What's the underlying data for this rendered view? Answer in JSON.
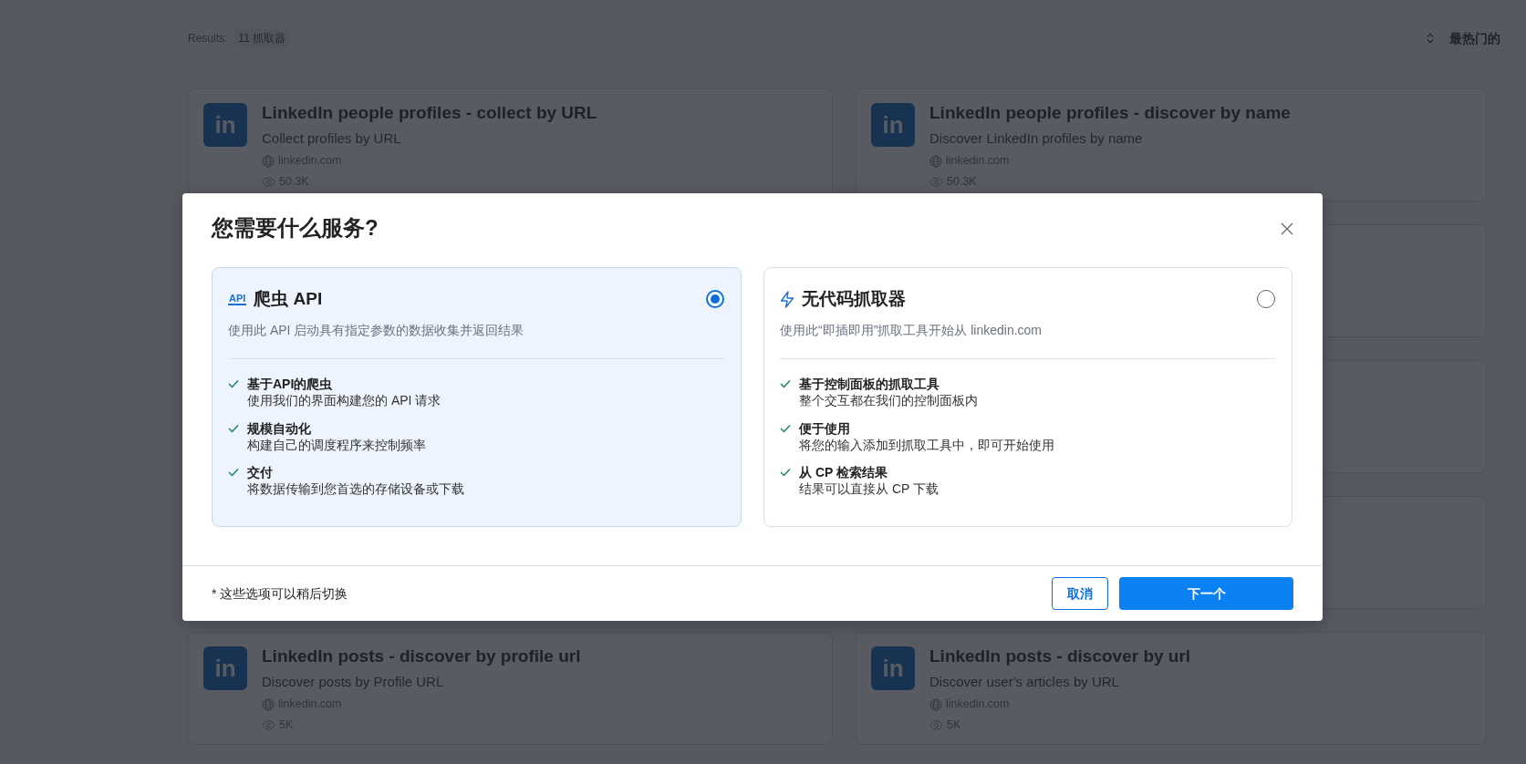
{
  "results": {
    "label": "Results:",
    "count": "11 抓取器"
  },
  "sort": {
    "label": "最热门的"
  },
  "cards": [
    {
      "logo": "in",
      "title": "LinkedIn people profiles - collect by URL",
      "subtitle": "Collect profiles by URL",
      "domain": "linkedin.com",
      "views": "50.3K"
    },
    {
      "logo": "in",
      "title": "LinkedIn people profiles - discover by name",
      "subtitle": "Discover LinkedIn profiles by name",
      "domain": "linkedin.com",
      "views": "50.3K"
    },
    {
      "logo": "in",
      "title": "LinkedIn posts - discover by profile url",
      "subtitle": "Discover posts by Profile URL",
      "domain": "linkedin.com",
      "views": "5K"
    },
    {
      "logo": "in",
      "title": "LinkedIn posts - discover by url",
      "subtitle": "Discover user's articles by URL",
      "domain": "linkedin.com",
      "views": "5K"
    }
  ],
  "modal": {
    "title": "您需要什么服务?",
    "options": [
      {
        "icon": {
          "kind": "text",
          "text": "API"
        },
        "title": "爬虫 API",
        "description": "使用此 API 启动具有指定参数的数据收集并返回结果",
        "selected": true,
        "features": [
          {
            "title": "基于API的爬虫",
            "text": "使用我们的界面构建您的 API 请求"
          },
          {
            "title": "规模自动化",
            "text": "构建自己的调度程序来控制频率"
          },
          {
            "title": "交付",
            "text": "将数据传输到您首选的存储设备或下载"
          }
        ]
      },
      {
        "icon": {
          "kind": "bolt"
        },
        "title": "无代码抓取器",
        "description": "使用此“即插即用”抓取工具开始从 linkedin.com",
        "selected": false,
        "features": [
          {
            "title": "基于控制面板的抓取工具",
            "text": "整个交互都在我们的控制面板内"
          },
          {
            "title": "便于使用",
            "text": "将您的输入添加到抓取工具中，即可开始使用"
          },
          {
            "title": "从 CP 检索结果",
            "text": "结果可以直接从 CP 下载"
          }
        ]
      }
    ],
    "note": "* 这些选项可以稍后切换",
    "cancel": "取消",
    "next": "下一个"
  }
}
